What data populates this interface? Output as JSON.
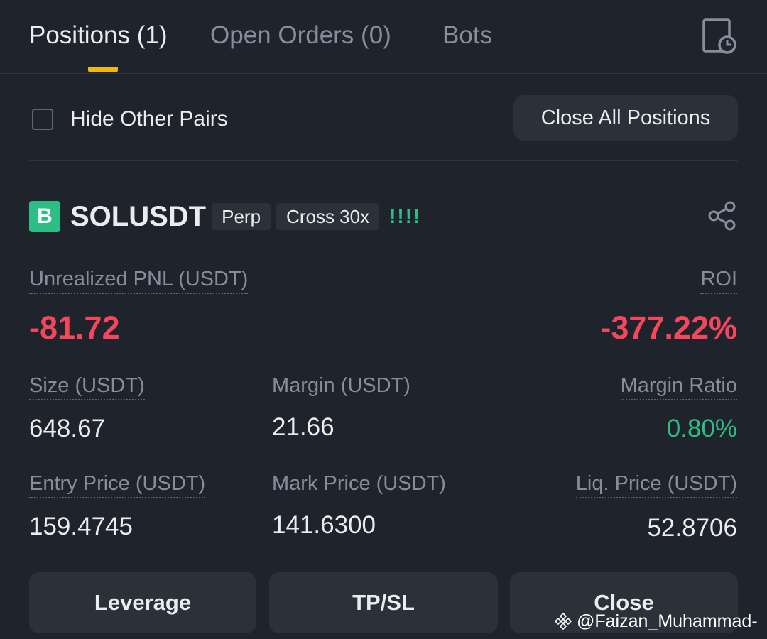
{
  "tabs": [
    {
      "label": "Positions (1)",
      "active": true
    },
    {
      "label": "Open Orders (0)",
      "active": false
    },
    {
      "label": "Bots",
      "active": false
    }
  ],
  "filters": {
    "hide_other_pairs_label": "Hide Other Pairs",
    "hide_other_pairs_checked": false,
    "close_all_label": "Close All Positions"
  },
  "position": {
    "badge": "B",
    "symbol": "SOLUSDT",
    "contract_tag": "Perp",
    "margin_mode_tag": "Cross 30x",
    "risk_bars": "!!!!",
    "unrealized_pnl_label": "Unrealized PNL (USDT)",
    "unrealized_pnl_value": "-81.72",
    "roi_label": "ROI",
    "roi_value": "-377.22%",
    "size_label": "Size (USDT)",
    "size_value": "648.67",
    "margin_label": "Margin (USDT)",
    "margin_value": "21.66",
    "margin_ratio_label": "Margin Ratio",
    "margin_ratio_value": "0.80%",
    "entry_price_label": "Entry Price (USDT)",
    "entry_price_value": "159.4745",
    "mark_price_label": "Mark Price (USDT)",
    "mark_price_value": "141.6300",
    "liq_price_label": "Liq. Price (USDT)",
    "liq_price_value": "52.8706"
  },
  "actions": {
    "leverage_label": "Leverage",
    "tpsl_label": "TP/SL",
    "close_label": "Close"
  },
  "watermark": {
    "text": "@Faizan_Muhammad-"
  },
  "colors": {
    "background": "#1f232b",
    "accent": "#f0b90b",
    "loss": "#f6465d",
    "gain": "#2ebd85",
    "muted_text": "#848e9c",
    "button_bg": "#2b3139"
  },
  "icons": {
    "history": "order-history-icon",
    "share": "share-icon",
    "watermark_logo": "binance-logo-icon"
  }
}
